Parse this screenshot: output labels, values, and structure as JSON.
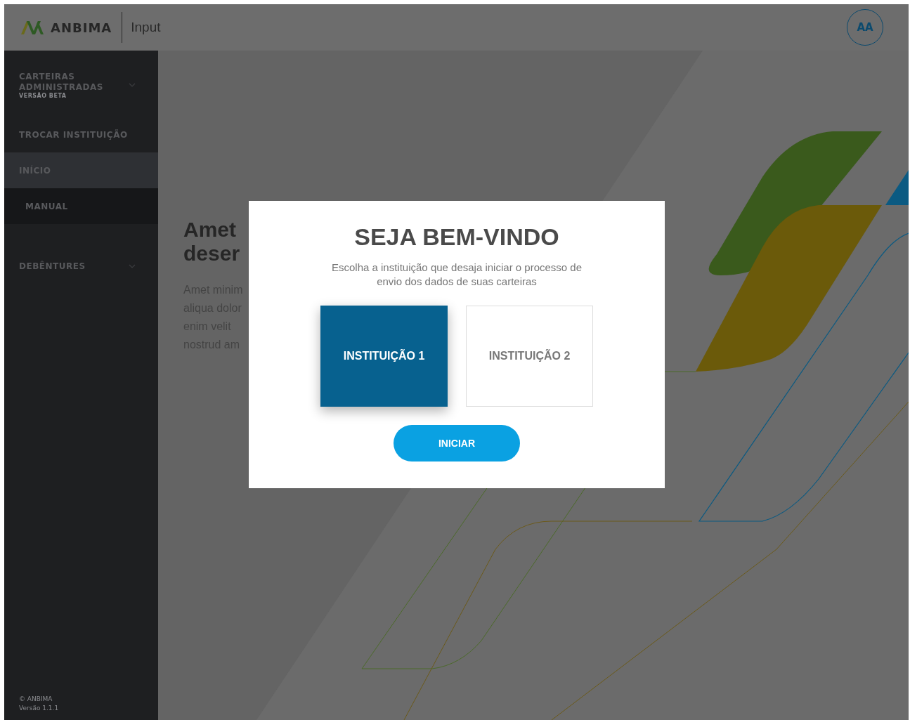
{
  "header": {
    "brand": "ANBIMA",
    "product": "Input",
    "avatar": "AA"
  },
  "sidebar": {
    "items": [
      {
        "kind": "group",
        "label": "CARTEIRAS ADMINISTRADAS",
        "sublabel": "VERSÃO BETA",
        "selected": false
      },
      {
        "kind": "item",
        "label": "TROCAR INSTITUIÇÃO",
        "selected": false
      },
      {
        "kind": "item",
        "label": "INÍCIO",
        "selected": true
      },
      {
        "kind": "subitem",
        "label": "MANUAL",
        "selected": false
      },
      {
        "kind": "group",
        "label": "DEBÊNTURES",
        "selected": false
      }
    ],
    "footer": [
      "© ANBIMA",
      "Versão 1.1.1"
    ]
  },
  "content": {
    "heading_lines": [
      "Amet",
      "deser"
    ],
    "paragraph_lines": [
      "Amet minim",
      "aliqua dolor",
      "enim velit",
      "nostrud am"
    ]
  },
  "modal": {
    "title": "SEJA BEM-VINDO",
    "text": "Escolha a instituição que desaja iniciar o processo de envio dos dados de suas carteiras",
    "options": [
      {
        "label": "INSTITUIÇÃO 1",
        "selected": true
      },
      {
        "label": "INSTITUIÇÃO 2",
        "selected": false
      }
    ],
    "button": "INICIAR"
  }
}
